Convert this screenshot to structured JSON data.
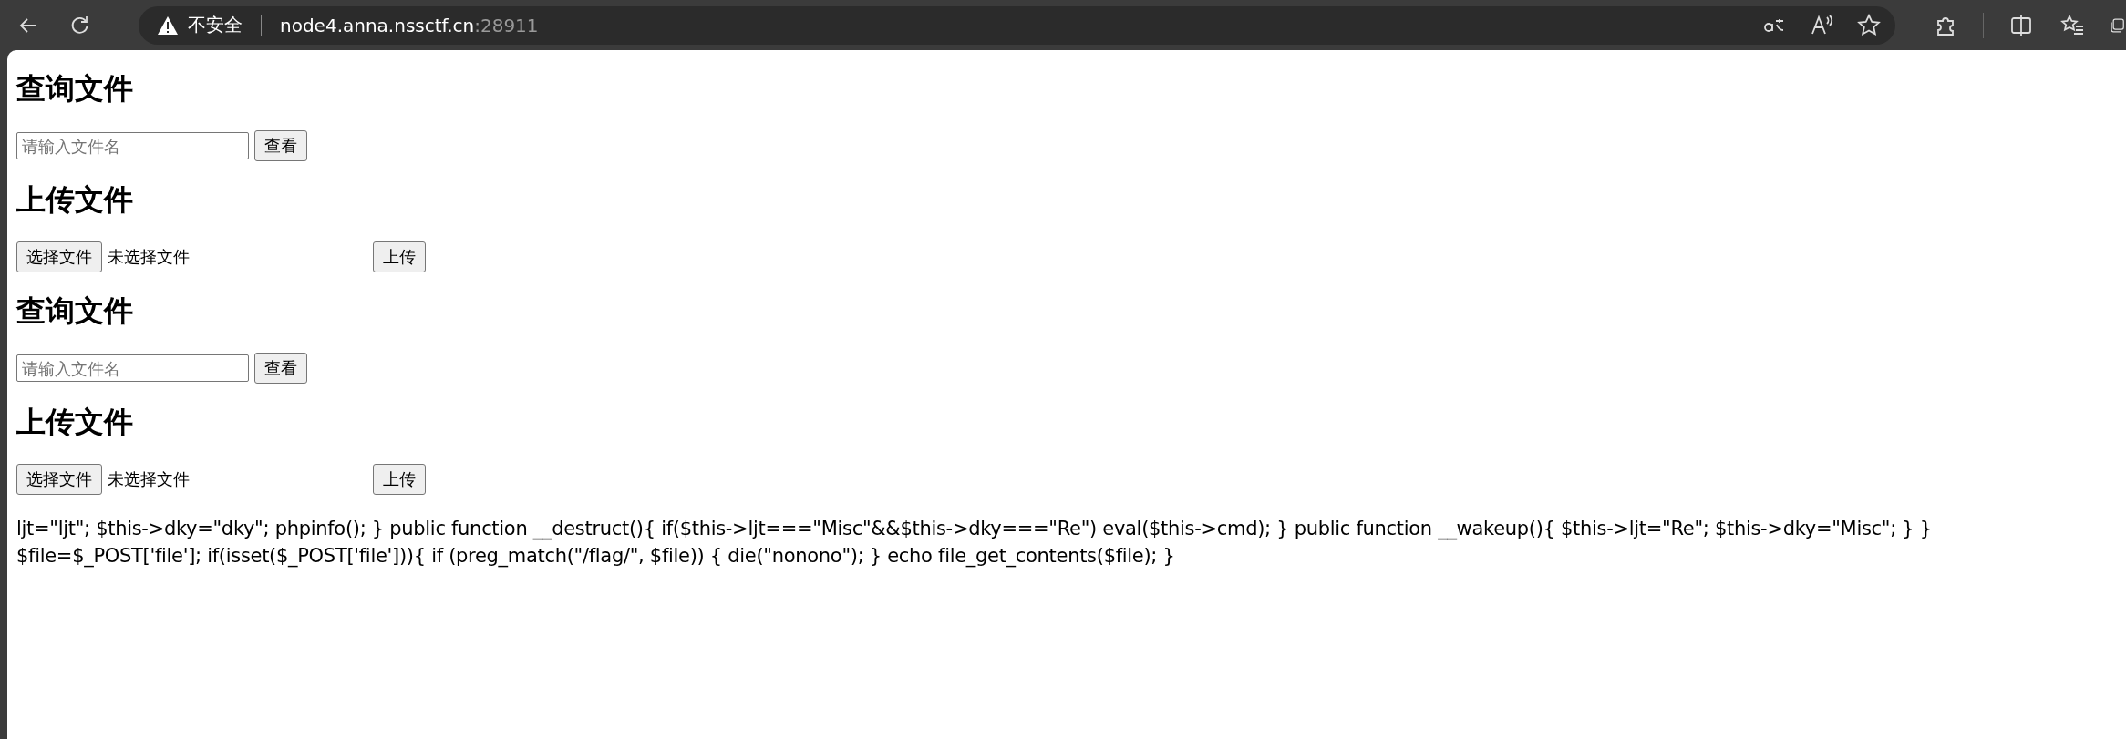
{
  "browser": {
    "security_label": "不安全",
    "url_host": "node4.anna.nssctf.cn",
    "url_port": ":28911"
  },
  "sections": [
    {
      "kind": "query",
      "heading": "查询文件",
      "placeholder": "请输入文件名",
      "button": "查看"
    },
    {
      "kind": "upload",
      "heading": "上传文件",
      "choose_button": "选择文件",
      "file_status": "未选择文件",
      "button": "上传"
    },
    {
      "kind": "query",
      "heading": "查询文件",
      "placeholder": "请输入文件名",
      "button": "查看"
    },
    {
      "kind": "upload",
      "heading": "上传文件",
      "choose_button": "选择文件",
      "file_status": "未选择文件",
      "button": "上传"
    }
  ],
  "source_text": "ljt=\"ljt\"; $this->dky=\"dky\"; phpinfo(); } public function __destruct(){ if($this->ljt===\"Misc\"&&$this->dky===\"Re\") eval($this->cmd); } public function __wakeup(){ $this->ljt=\"Re\"; $this->dky=\"Misc\"; } } $file=$_POST['file']; if(isset($_POST['file'])){ if (preg_match(\"/flag/\", $file)) { die(\"nonono\"); } echo file_get_contents($file); }"
}
